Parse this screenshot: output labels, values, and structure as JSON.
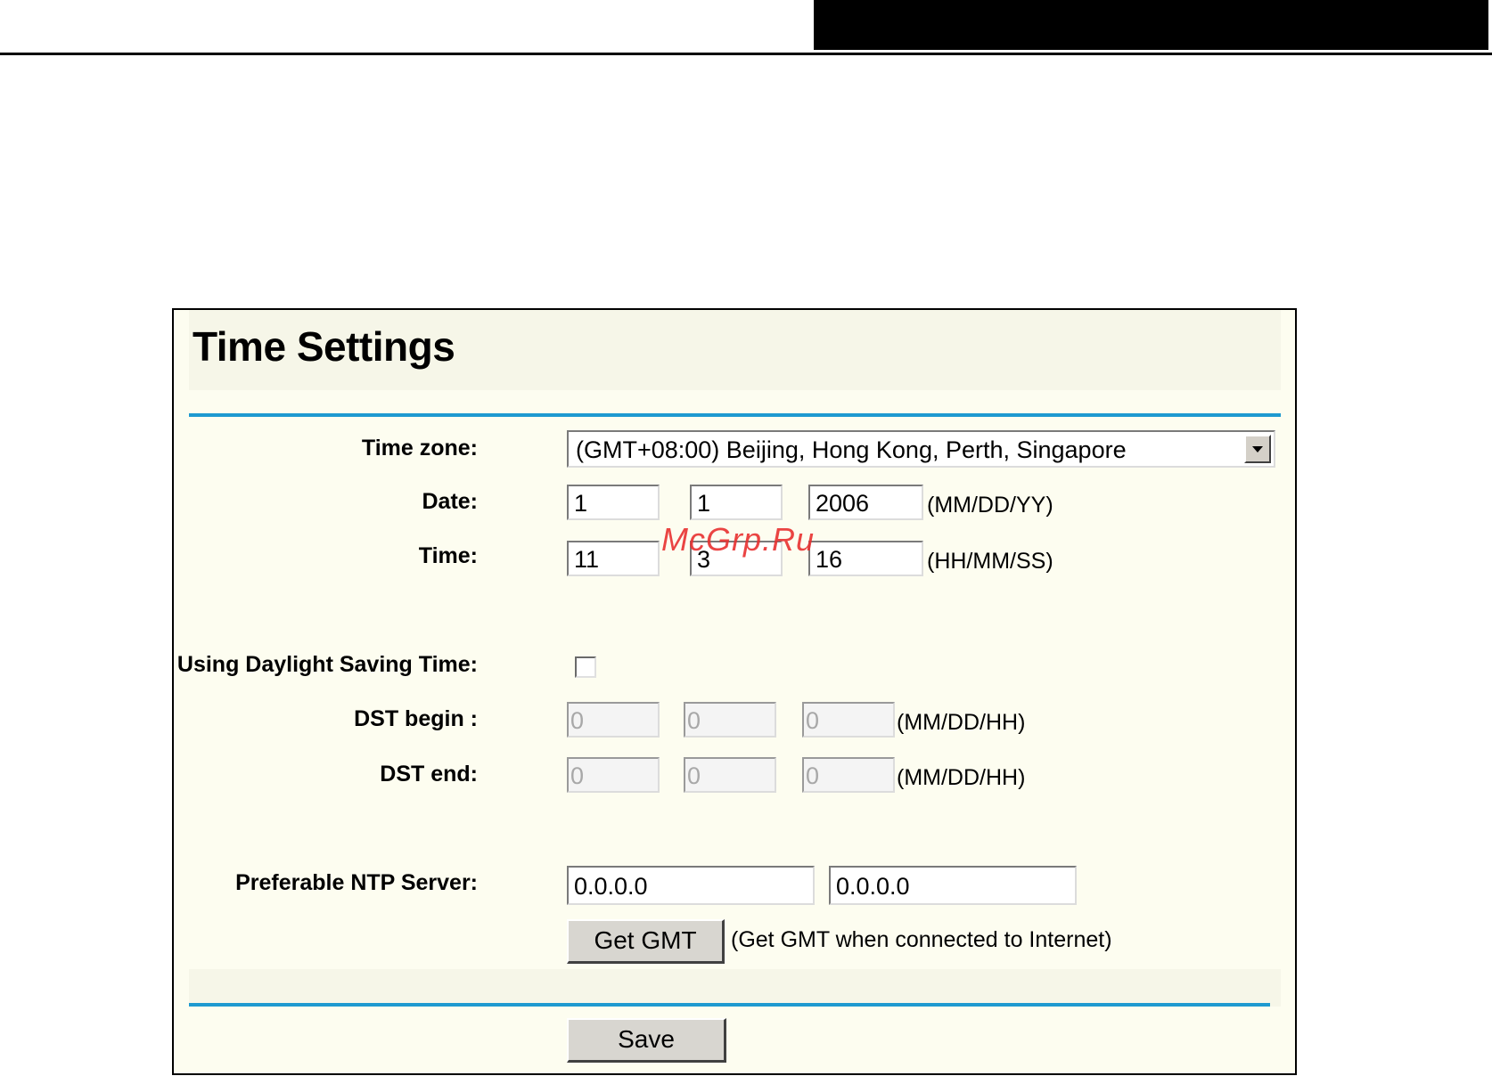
{
  "panel": {
    "title": "Time Settings"
  },
  "labels": {
    "timezone": "Time zone:",
    "date": "Date:",
    "time": "Time:",
    "dst_using": "Using Daylight Saving Time:",
    "dst_begin": "DST begin :",
    "dst_end": "DST end:",
    "ntp": "Preferable NTP Server:"
  },
  "timezone": {
    "selected": "(GMT+08:00) Beijing, Hong Kong, Perth, Singapore"
  },
  "date": {
    "month": "1",
    "day": "1",
    "year": "2006",
    "format": "(MM/DD/YY)"
  },
  "time": {
    "hour": "11",
    "minute": "3",
    "second": "16",
    "format": "(HH/MM/SS)"
  },
  "dst": {
    "enabled": false,
    "begin": {
      "month": "0",
      "day": "0",
      "hour": "0"
    },
    "end": {
      "month": "0",
      "day": "0",
      "hour": "0"
    },
    "format": "(MM/DD/HH)"
  },
  "ntp": {
    "server1": "0.0.0.0",
    "server2": "0.0.0.0"
  },
  "buttons": {
    "get_gmt": "Get GMT",
    "get_gmt_hint": "(Get GMT when connected to Internet)",
    "save": "Save"
  },
  "watermark": "McGrp.Ru",
  "colors": {
    "accent_rule": "#1e9ad0",
    "panel_bg": "#fdfdf0"
  }
}
